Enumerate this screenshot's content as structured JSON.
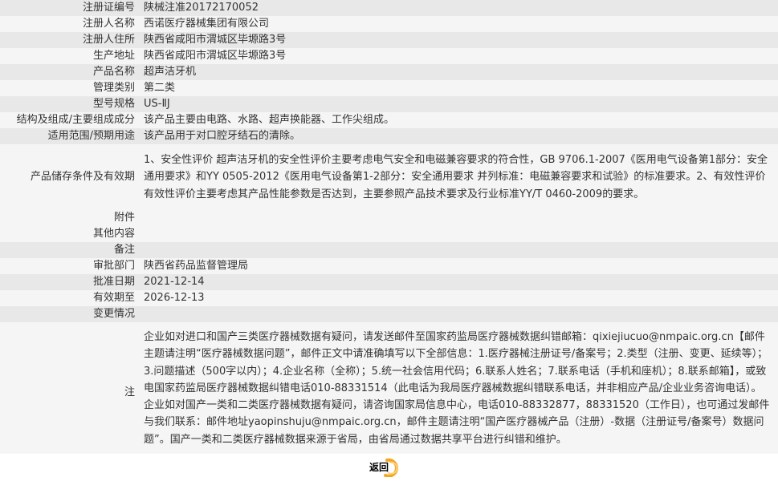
{
  "fields": [
    {
      "label": "注册证编号",
      "value": "陕械注准20172170052"
    },
    {
      "label": "注册人名称",
      "value": "西诺医疗器械集团有限公司"
    },
    {
      "label": "注册人住所",
      "value": "陕西省咸阳市渭城区毕塬路3号"
    },
    {
      "label": "生产地址",
      "value": "陕西省咸阳市渭城区毕塬路3号"
    },
    {
      "label": "产品名称",
      "value": "超声洁牙机"
    },
    {
      "label": "管理类别",
      "value": "第二类"
    },
    {
      "label": "型号规格",
      "value": "US-ⅡJ"
    },
    {
      "label": "结构及组成/主要组成成分",
      "value": "该产品主要由电路、水路、超声换能器、工作尖组成。"
    },
    {
      "label": "适用范围/预期用途",
      "value": "该产品用于对口腔牙结石的清除。"
    },
    {
      "label": "产品储存条件及有效期",
      "value": "1、安全性评价 超声洁牙机的安全性评价主要考虑电气安全和电磁兼容要求的符合性，GB 9706.1-2007《医用电气设备第1部分：安全通用要求》和YY 0505-2012《医用电气设备第1-2部分：安全通用要求 并列标准：电磁兼容要求和试验》的标准要求。2、有效性评价 有效性评价主要考虑其产品性能参数是否达到，主要参照产品技术要求及行业标准YY/T 0460-2009的要求。"
    },
    {
      "label": "附件",
      "value": ""
    },
    {
      "label": "其他内容",
      "value": ""
    },
    {
      "label": "备注",
      "value": ""
    },
    {
      "label": "审批部门",
      "value": "陕西省药品监督管理局"
    },
    {
      "label": "批准日期",
      "value": "2021-12-14"
    },
    {
      "label": "有效期至",
      "value": "2026-12-13"
    },
    {
      "label": "变更情况",
      "value": ""
    }
  ],
  "note": {
    "label": "注",
    "text": "企业如对进口和国产三类医疗器械数据有疑问，请发送邮件至国家药监局医疗器械数据纠错邮箱：qixiejiucuo@nmpaic.org.cn【邮件主题请注明“医疗器械数据问题”，邮件正文中请准确填写以下全部信息：1.医疗器械注册证号/备案号；2.类型（注册、变更、延续等）；3.问题描述（500字以内）；4.企业名称（全称）；5.统一社会信用代码；6.联系人姓名；7.联系电话（手机和座机）；8.联系邮箱】，或致电国家药监局医疗器械数据纠错电话010-88331514（此电话为我局医疗器械数据纠错联系电话，并非相应产品/企业业务咨询电话）。企业如对国产一类和二类医疗器械数据有疑问，请咨询国家局信息中心，电话010-88332877，88331520（工作日），也可通过发邮件与我们联系：邮件地址yaopinshuju@nmpaic.org.cn，邮件主题请注明“国产医疗器械产品（注册）-数据（注册证号/备案号）数据问题”。国产一类和二类医疗器械数据来源于省局，由省局通过数据共享平台进行纠错和维护。"
  },
  "back_button": {
    "label": "返回"
  },
  "colors": {
    "row_odd": "#e8e8e8",
    "row_even": "#f5f5f5",
    "button_accent": "#f5a623"
  }
}
